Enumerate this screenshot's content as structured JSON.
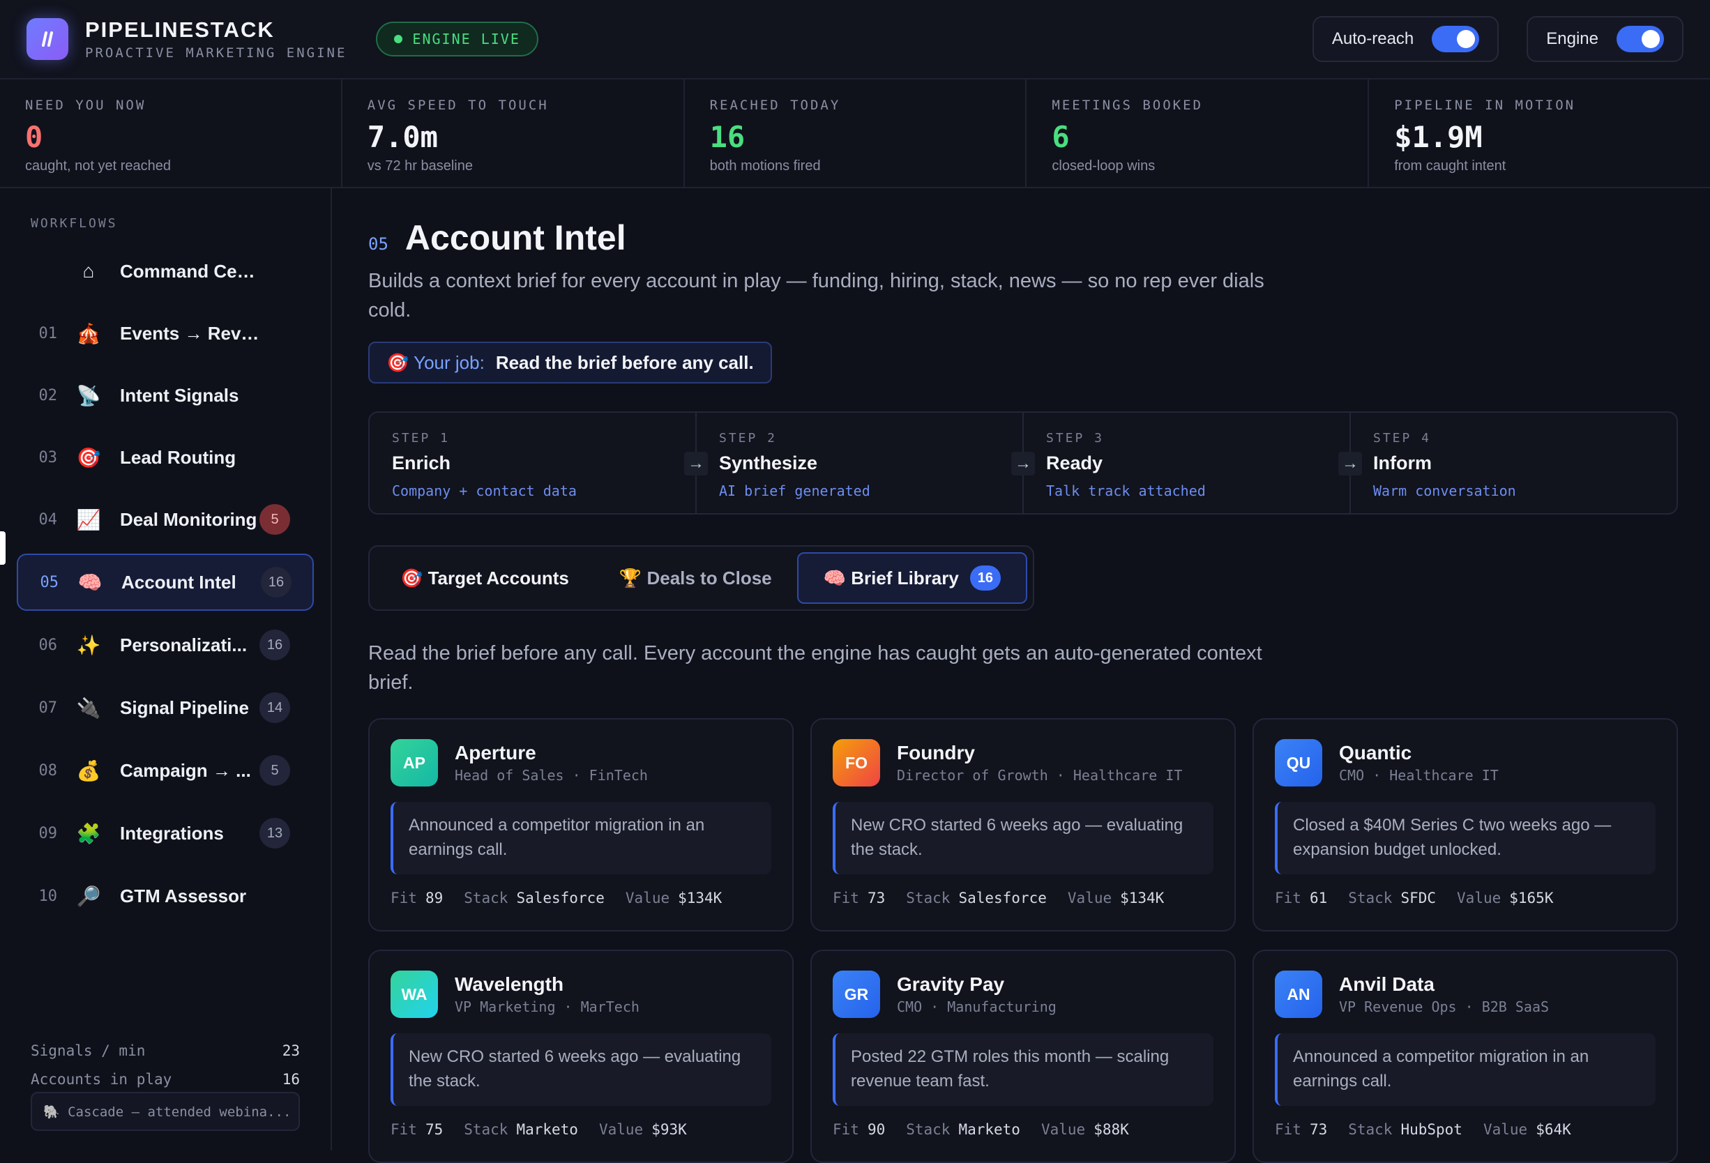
{
  "header": {
    "brand_title": "PIPELINESTACK",
    "brand_sub": "PROACTIVE MARKETING ENGINE",
    "live_label": "ENGINE LIVE",
    "toggle_autoreach": "Auto-reach",
    "toggle_engine": "Engine"
  },
  "kpis": [
    {
      "label": "NEED YOU NOW",
      "value": "0",
      "sub": "caught, not yet reached",
      "color": "#f87171"
    },
    {
      "label": "AVG SPEED TO TOUCH",
      "value": "7.0m",
      "sub": "vs 72 hr baseline",
      "color": "#f3f4f8"
    },
    {
      "label": "REACHED TODAY",
      "value": "16",
      "sub": "both motions fired",
      "color": "#4ade80"
    },
    {
      "label": "MEETINGS BOOKED",
      "value": "6",
      "sub": "closed-loop wins",
      "color": "#4ade80"
    },
    {
      "label": "PIPELINE IN MOTION",
      "value": "$1.9M",
      "sub": "from caught intent",
      "color": "#f3f4f8"
    }
  ],
  "sidebar": {
    "heading": "WORKFLOWS",
    "items": [
      {
        "num": "",
        "icon": "⌂",
        "icon_name": "home-icon",
        "label": "Command Center",
        "badge": ""
      },
      {
        "num": "01",
        "icon": "🎪",
        "icon_name": "circus-tent-icon",
        "label": "Events → Revenue",
        "badge": ""
      },
      {
        "num": "02",
        "icon": "📡",
        "icon_name": "satellite-dish-icon",
        "label": "Intent Signals",
        "badge": ""
      },
      {
        "num": "03",
        "icon": "🎯",
        "icon_name": "target-icon",
        "label": "Lead Routing",
        "badge": ""
      },
      {
        "num": "04",
        "icon": "📈",
        "icon_name": "chart-up-icon",
        "label": "Deal Monitoring",
        "badge": "5"
      },
      {
        "num": "05",
        "icon": "🧠",
        "icon_name": "brain-icon",
        "label": "Account Intel",
        "badge": "16"
      },
      {
        "num": "06",
        "icon": "✨",
        "icon_name": "sparkles-icon",
        "label": "Personalizati...",
        "badge": "16"
      },
      {
        "num": "07",
        "icon": "🔌",
        "icon_name": "plug-icon",
        "label": "Signal Pipeline",
        "badge": "14"
      },
      {
        "num": "08",
        "icon": "💰",
        "icon_name": "money-bag-icon",
        "label": "Campaign → ...",
        "badge": "5"
      },
      {
        "num": "09",
        "icon": "🧩",
        "icon_name": "puzzle-icon",
        "label": "Integrations",
        "badge": "13"
      },
      {
        "num": "10",
        "icon": "🔎",
        "icon_name": "magnifier-icon",
        "label": "GTM Assessor",
        "badge": ""
      }
    ],
    "stats": [
      {
        "label": "Signals / min",
        "value": "23"
      },
      {
        "label": "Accounts in play",
        "value": "16"
      }
    ],
    "cascade": "🐘 Cascade — attended webina..."
  },
  "main": {
    "num": "05",
    "title": "Account Intel",
    "description": "Builds a context brief for every account in play — funding, hiring, stack, news — so no rep ever dials cold.",
    "job_label": "🎯 Your job:",
    "job_text": "Read the brief before any call.",
    "steps": [
      {
        "label": "STEP 1",
        "title": "Enrich",
        "sub": "Company + contact data"
      },
      {
        "label": "STEP 2",
        "title": "Synthesize",
        "sub": "AI brief generated"
      },
      {
        "label": "STEP 3",
        "title": "Ready",
        "sub": "Talk track attached"
      },
      {
        "label": "STEP 4",
        "title": "Inform",
        "sub": "Warm conversation"
      }
    ],
    "tabs": [
      {
        "label": "🎯 Target Accounts",
        "badge": ""
      },
      {
        "label": "🏆 Deals to Close",
        "badge": ""
      },
      {
        "label": "🧠 Brief Library",
        "badge": "16"
      }
    ],
    "library_desc": "Read the brief before any call. Every account the engine has caught gets an auto-generated context brief.",
    "cards": [
      {
        "initials": "AP",
        "name": "Aperture",
        "role": "Head of Sales · FinTech",
        "note": "Announced a competitor migration in an earnings call.",
        "fit": "89",
        "stack": "Salesforce",
        "value": "$134K",
        "color_a": "#34d399",
        "color_b": "#14b8a6"
      },
      {
        "initials": "FO",
        "name": "Foundry",
        "role": "Director of Growth · Healthcare IT",
        "note": "New CRO started 6 weeks ago — evaluating the stack.",
        "fit": "73",
        "stack": "Salesforce",
        "value": "$134K",
        "color_a": "#f59e0b",
        "color_b": "#ef4444"
      },
      {
        "initials": "QU",
        "name": "Quantic",
        "role": "CMO · Healthcare IT",
        "note": "Closed a $40M Series C two weeks ago — expansion budget unlocked.",
        "fit": "61",
        "stack": "SFDC",
        "value": "$165K",
        "color_a": "#3b82f6",
        "color_b": "#2563eb"
      },
      {
        "initials": "WA",
        "name": "Wavelength",
        "role": "VP Marketing · MarTech",
        "note": "New CRO started 6 weeks ago — evaluating the stack.",
        "fit": "75",
        "stack": "Marketo",
        "value": "$93K",
        "color_a": "#34d399",
        "color_b": "#22d3ee"
      },
      {
        "initials": "GR",
        "name": "Gravity Pay",
        "role": "CMO · Manufacturing",
        "note": "Posted 22 GTM roles this month — scaling revenue team fast.",
        "fit": "90",
        "stack": "Marketo",
        "value": "$88K",
        "color_a": "#3b82f6",
        "color_b": "#2563eb"
      },
      {
        "initials": "AN",
        "name": "Anvil Data",
        "role": "VP Revenue Ops · B2B SaaS",
        "note": "Announced a competitor migration in an earnings call.",
        "fit": "73",
        "stack": "HubSpot",
        "value": "$64K",
        "color_a": "#3b82f6",
        "color_b": "#2563eb"
      }
    ],
    "stat_keys": {
      "fit": "Fit",
      "stack": "Stack",
      "value": "Value"
    }
  }
}
